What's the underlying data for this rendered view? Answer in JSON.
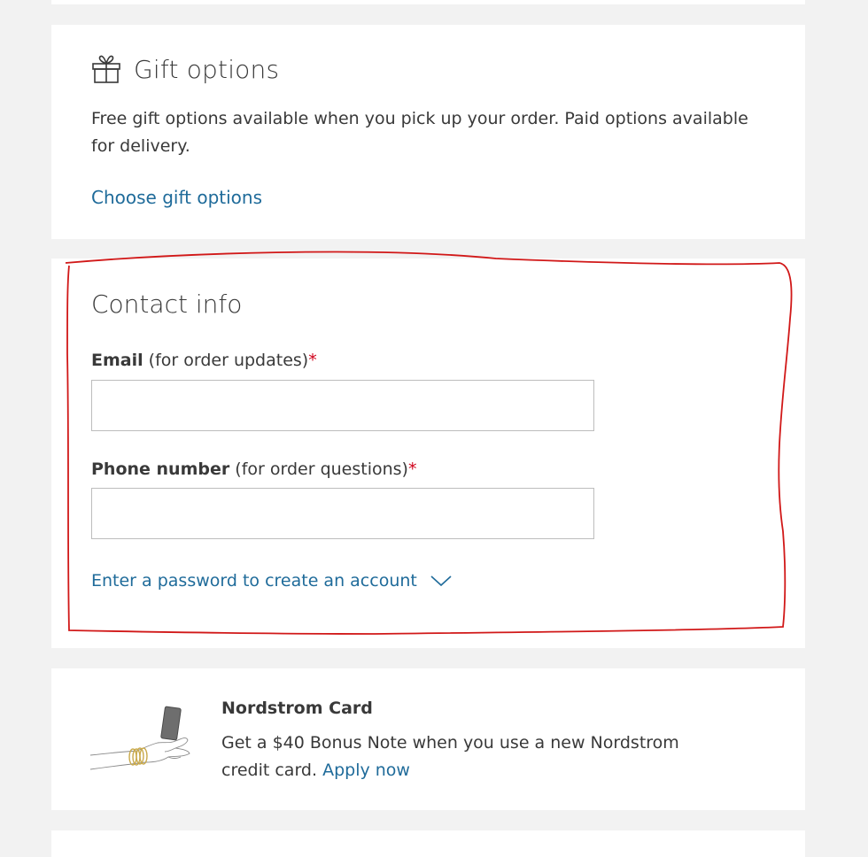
{
  "gift_options": {
    "title": "Gift options",
    "icon": "gift-icon",
    "description": "Free gift options available when you pick up your order. Paid options available for delivery.",
    "link": "Choose gift options"
  },
  "contact_info": {
    "title": "Contact info",
    "email": {
      "label_strong": "Email",
      "label_note": " (for order updates)",
      "required_mark": "*",
      "value": "",
      "placeholder": ""
    },
    "phone": {
      "label_strong": "Phone number",
      "label_note": " (for order questions)",
      "required_mark": "*",
      "value": "",
      "placeholder": ""
    },
    "password_link": "Enter a password to create an account",
    "password_icon": "chevron-down-icon"
  },
  "nordstrom_card": {
    "title": "Nordstrom Card",
    "text": "Get a $40 Bonus Note when you use a new Nordstrom credit card.",
    "link": "Apply now",
    "image": "hand-holding-card-illustration"
  },
  "colors": {
    "link": "#1f6b9a",
    "required": "#d0021b",
    "annotation": "#d11818",
    "background": "#f2f2f2"
  }
}
